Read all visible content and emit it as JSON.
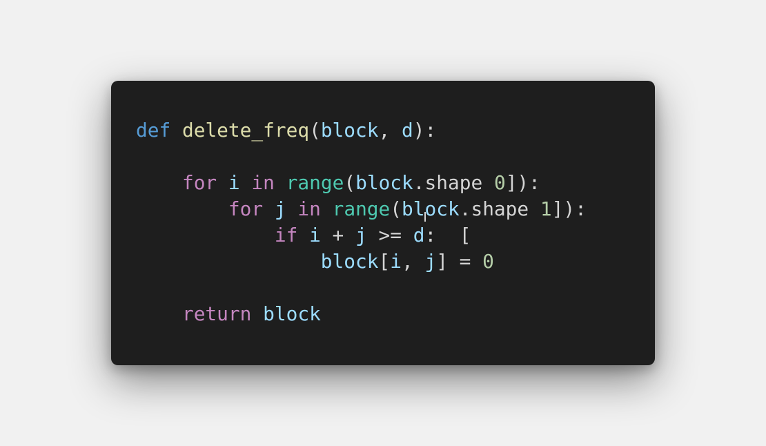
{
  "colors": {
    "page_background": "#f1f1f1",
    "card_background": "#1e1e1e",
    "keyword_def": "#569cd6",
    "keyword_control": "#c586c0",
    "function_name": "#dcdcaa",
    "builtin": "#4ec9b0",
    "variable": "#9cdcfe",
    "number": "#b5cea8",
    "plain": "#d4d4d4"
  },
  "code": {
    "language": "python",
    "lines": [
      [
        {
          "t": "def",
          "c": "kw-def"
        },
        {
          "t": " ",
          "c": "plain"
        },
        {
          "t": "delete_freq",
          "c": "fn"
        },
        {
          "t": "(",
          "c": "plain"
        },
        {
          "t": "block",
          "c": "var"
        },
        {
          "t": ", ",
          "c": "plain"
        },
        {
          "t": "d",
          "c": "var"
        },
        {
          "t": "):",
          "c": "plain"
        }
      ],
      [],
      [
        {
          "t": "    ",
          "c": "plain"
        },
        {
          "t": "for",
          "c": "kw-ctl"
        },
        {
          "t": " ",
          "c": "plain"
        },
        {
          "t": "i",
          "c": "var"
        },
        {
          "t": " ",
          "c": "plain"
        },
        {
          "t": "in",
          "c": "kw-ctl"
        },
        {
          "t": " ",
          "c": "plain"
        },
        {
          "t": "range",
          "c": "builtin"
        },
        {
          "t": "(",
          "c": "plain"
        },
        {
          "t": "block",
          "c": "var"
        },
        {
          "t": ".shape ",
          "c": "plain"
        },
        {
          "t": "0",
          "c": "num"
        },
        {
          "t": "]):",
          "c": "plain"
        }
      ],
      [
        {
          "t": "        ",
          "c": "plain"
        },
        {
          "t": "for",
          "c": "kw-ctl"
        },
        {
          "t": " ",
          "c": "plain"
        },
        {
          "t": "j",
          "c": "var"
        },
        {
          "t": " ",
          "c": "plain"
        },
        {
          "t": "in",
          "c": "kw-ctl"
        },
        {
          "t": " ",
          "c": "plain"
        },
        {
          "t": "range",
          "c": "builtin"
        },
        {
          "t": "(",
          "c": "plain"
        },
        {
          "t": "block",
          "c": "var"
        },
        {
          "t": ".shape ",
          "c": "plain"
        },
        {
          "t": "1",
          "c": "num"
        },
        {
          "t": "]):",
          "c": "plain"
        }
      ],
      [
        {
          "t": "            ",
          "c": "plain"
        },
        {
          "t": "if",
          "c": "kw-ctl"
        },
        {
          "t": " ",
          "c": "plain"
        },
        {
          "t": "i",
          "c": "var"
        },
        {
          "t": " + ",
          "c": "plain"
        },
        {
          "t": "j",
          "c": "var"
        },
        {
          "t": " >= ",
          "c": "plain"
        },
        {
          "t": "d",
          "c": "var"
        },
        {
          "t": ":  [",
          "c": "plain"
        }
      ],
      [
        {
          "t": "                ",
          "c": "plain"
        },
        {
          "t": "block",
          "c": "var"
        },
        {
          "t": "[",
          "c": "plain"
        },
        {
          "t": "i",
          "c": "var"
        },
        {
          "t": ", ",
          "c": "plain"
        },
        {
          "t": "j",
          "c": "var"
        },
        {
          "t": "] = ",
          "c": "plain"
        },
        {
          "t": "0",
          "c": "num"
        }
      ],
      [],
      [
        {
          "t": "    ",
          "c": "plain"
        },
        {
          "t": "return",
          "c": "kw-ctl"
        },
        {
          "t": " ",
          "c": "plain"
        },
        {
          "t": "block",
          "c": "var"
        }
      ]
    ]
  }
}
